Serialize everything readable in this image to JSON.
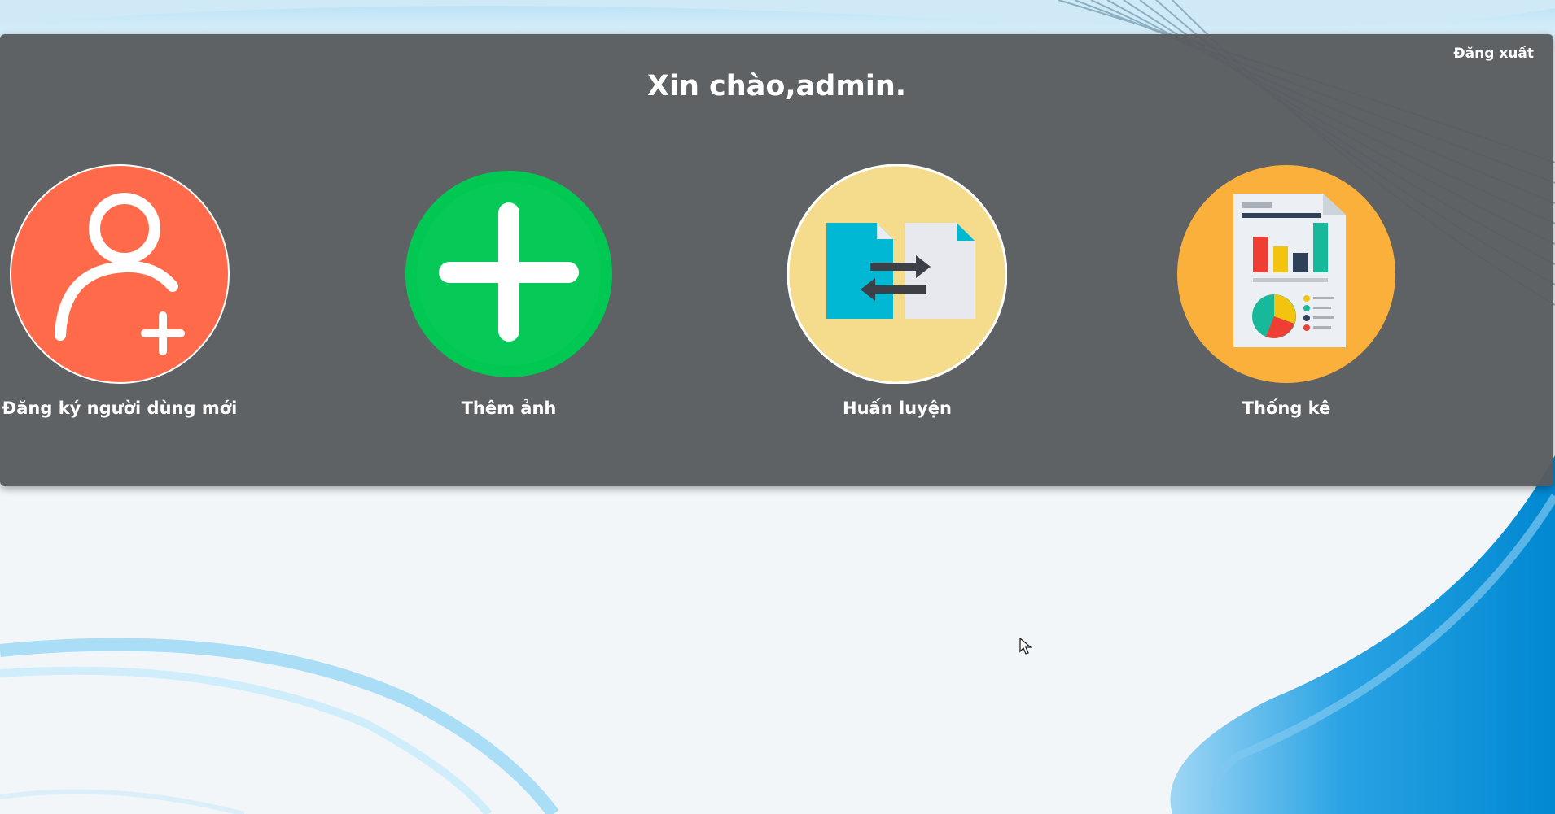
{
  "header": {
    "greeting": "Xin chào,admin.",
    "logout_label": "Đăng xuất"
  },
  "tiles": [
    {
      "label": "Đăng ký người dùng mới",
      "icon": "add-user-icon",
      "color": "#ff6b4a"
    },
    {
      "label": "Thêm ảnh",
      "icon": "plus-icon",
      "color": "#00c853"
    },
    {
      "label": "Huấn luyện",
      "icon": "file-transfer-icon",
      "color": "#f4dc8c"
    },
    {
      "label": "Thống kê",
      "icon": "report-chart-icon",
      "color": "#fbb03b"
    }
  ],
  "colors": {
    "panel": "#585c5f",
    "accent_blue": "#0090d8"
  }
}
